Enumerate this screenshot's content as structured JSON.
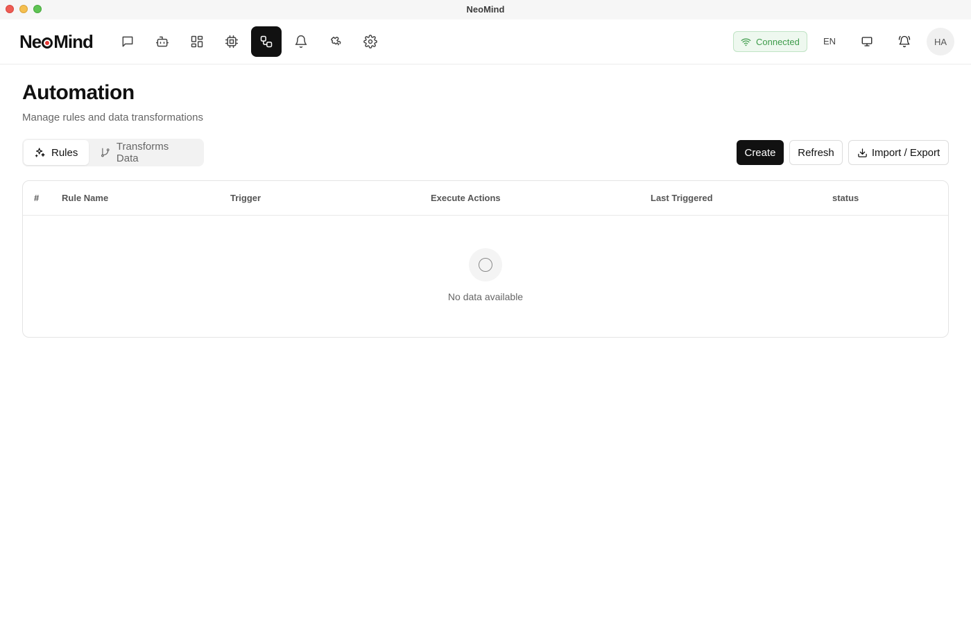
{
  "window": {
    "title": "NeoMind"
  },
  "header": {
    "logo": {
      "prefix": "Ne",
      "suffix": "Mind"
    },
    "nav": [
      {
        "name": "chat-icon"
      },
      {
        "name": "robot-icon"
      },
      {
        "name": "dashboard-icon"
      },
      {
        "name": "chip-icon"
      },
      {
        "name": "workflow-icon",
        "active": true
      },
      {
        "name": "bell-icon"
      },
      {
        "name": "puzzle-icon"
      },
      {
        "name": "gear-icon"
      }
    ],
    "connection_status": "Connected",
    "language": "EN",
    "avatar_initials": "HA"
  },
  "page": {
    "title": "Automation",
    "subtitle": "Manage rules and data transformations",
    "tabs": [
      {
        "label": "Rules",
        "icon": "sparkles-icon",
        "active": true
      },
      {
        "label": "Transforms Data",
        "icon": "git-branch-icon",
        "active": false
      }
    ],
    "actions": {
      "create": "Create",
      "refresh": "Refresh",
      "import_export": "Import / Export"
    },
    "table": {
      "columns": [
        "#",
        "Rule Name",
        "Trigger",
        "Execute Actions",
        "Last Triggered",
        "status"
      ],
      "rows": [],
      "empty_text": "No data available"
    }
  },
  "colors": {
    "accent": "#111111",
    "connected_text": "#3d9b4a",
    "connected_bg": "#eef8ef",
    "logo_dot": "#e53935"
  }
}
